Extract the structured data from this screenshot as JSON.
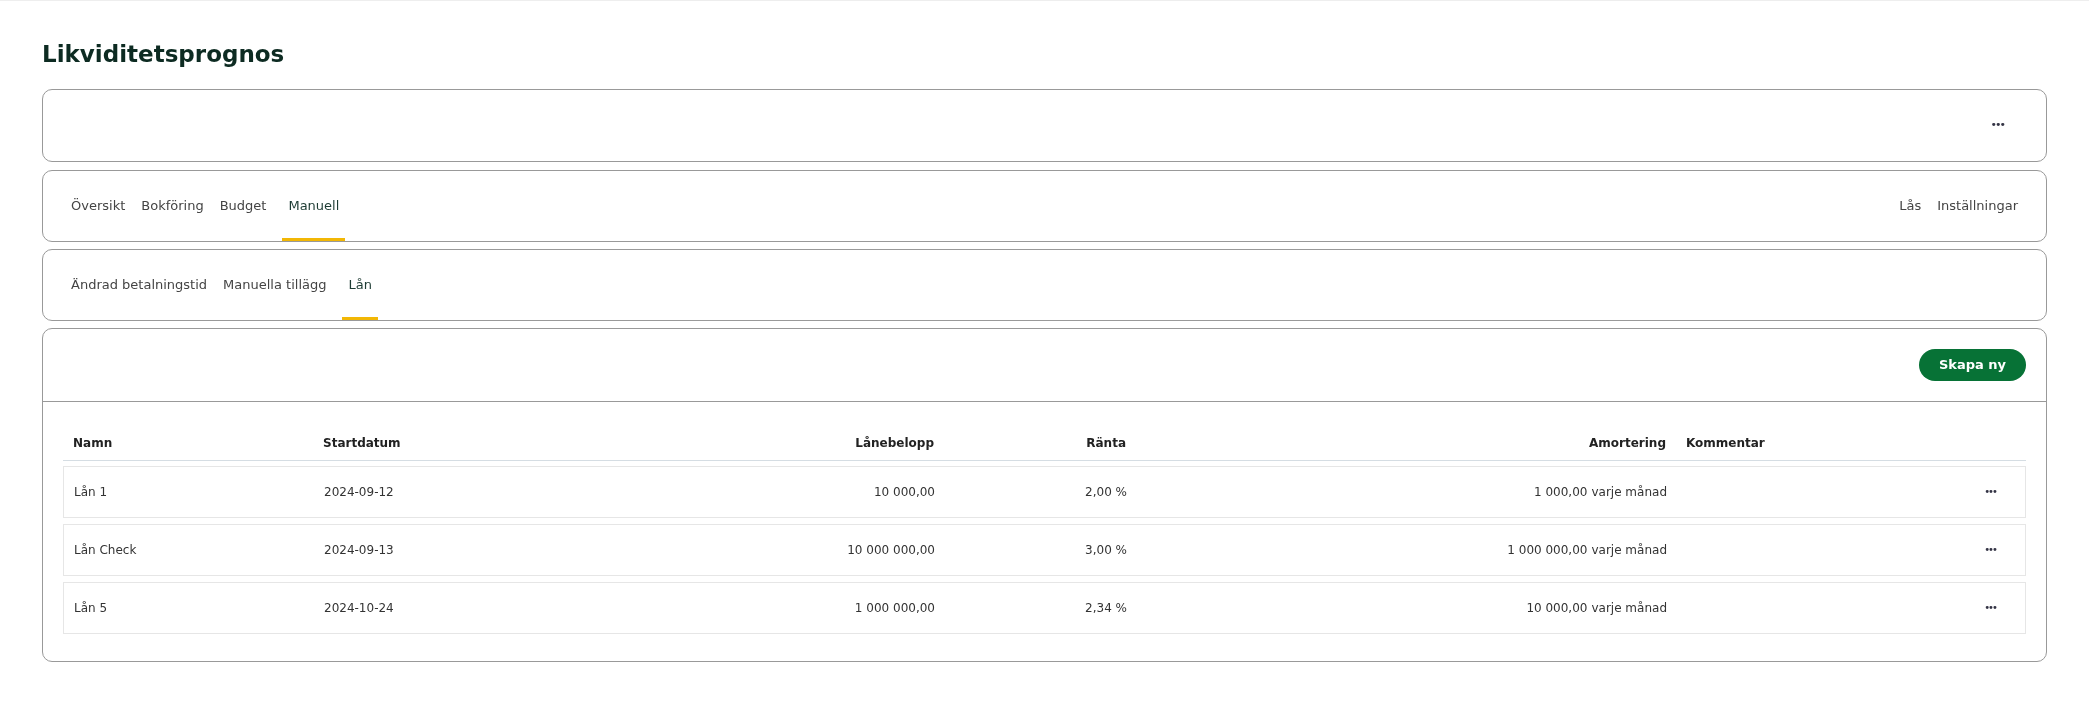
{
  "page_title": "Likviditetsprognos",
  "top_card": {
    "menu": "•••"
  },
  "main_tabs": [
    {
      "label": "Översikt",
      "selected": false
    },
    {
      "label": "Bokföring",
      "selected": false
    },
    {
      "label": "Budget",
      "selected": false
    },
    {
      "label": "Manuell",
      "selected": true
    }
  ],
  "main_actions": [
    "Lås",
    "Inställningar"
  ],
  "sub_tabs": [
    {
      "label": "Ändrad betalningstid",
      "selected": false
    },
    {
      "label": "Manuella tillägg",
      "selected": false
    },
    {
      "label": "Lån",
      "selected": true
    }
  ],
  "create_button": "Skapa ny",
  "table": {
    "columns": [
      "Namn",
      "Startdatum",
      "Lånebelopp",
      "Ränta",
      "Amortering",
      "Kommentar"
    ],
    "rows": [
      {
        "name": "Lån 1",
        "start_date": "2024-09-12",
        "amount": "10 000,00",
        "rate": "2,00 %",
        "amortization": "1 000,00",
        "period": "varje månad",
        "menu": "•••"
      },
      {
        "name": "Lån Check",
        "start_date": "2024-09-13",
        "amount": "10 000 000,00",
        "rate": "3,00 %",
        "amortization": "1 000 000,00",
        "period": "varje månad",
        "menu": "•••"
      },
      {
        "name": "Lån 5",
        "start_date": "2024-10-24",
        "amount": "1 000 000,00",
        "rate": "2,34 %",
        "amortization": "10 000,00",
        "period": "varje månad",
        "menu": "•••"
      }
    ]
  }
}
